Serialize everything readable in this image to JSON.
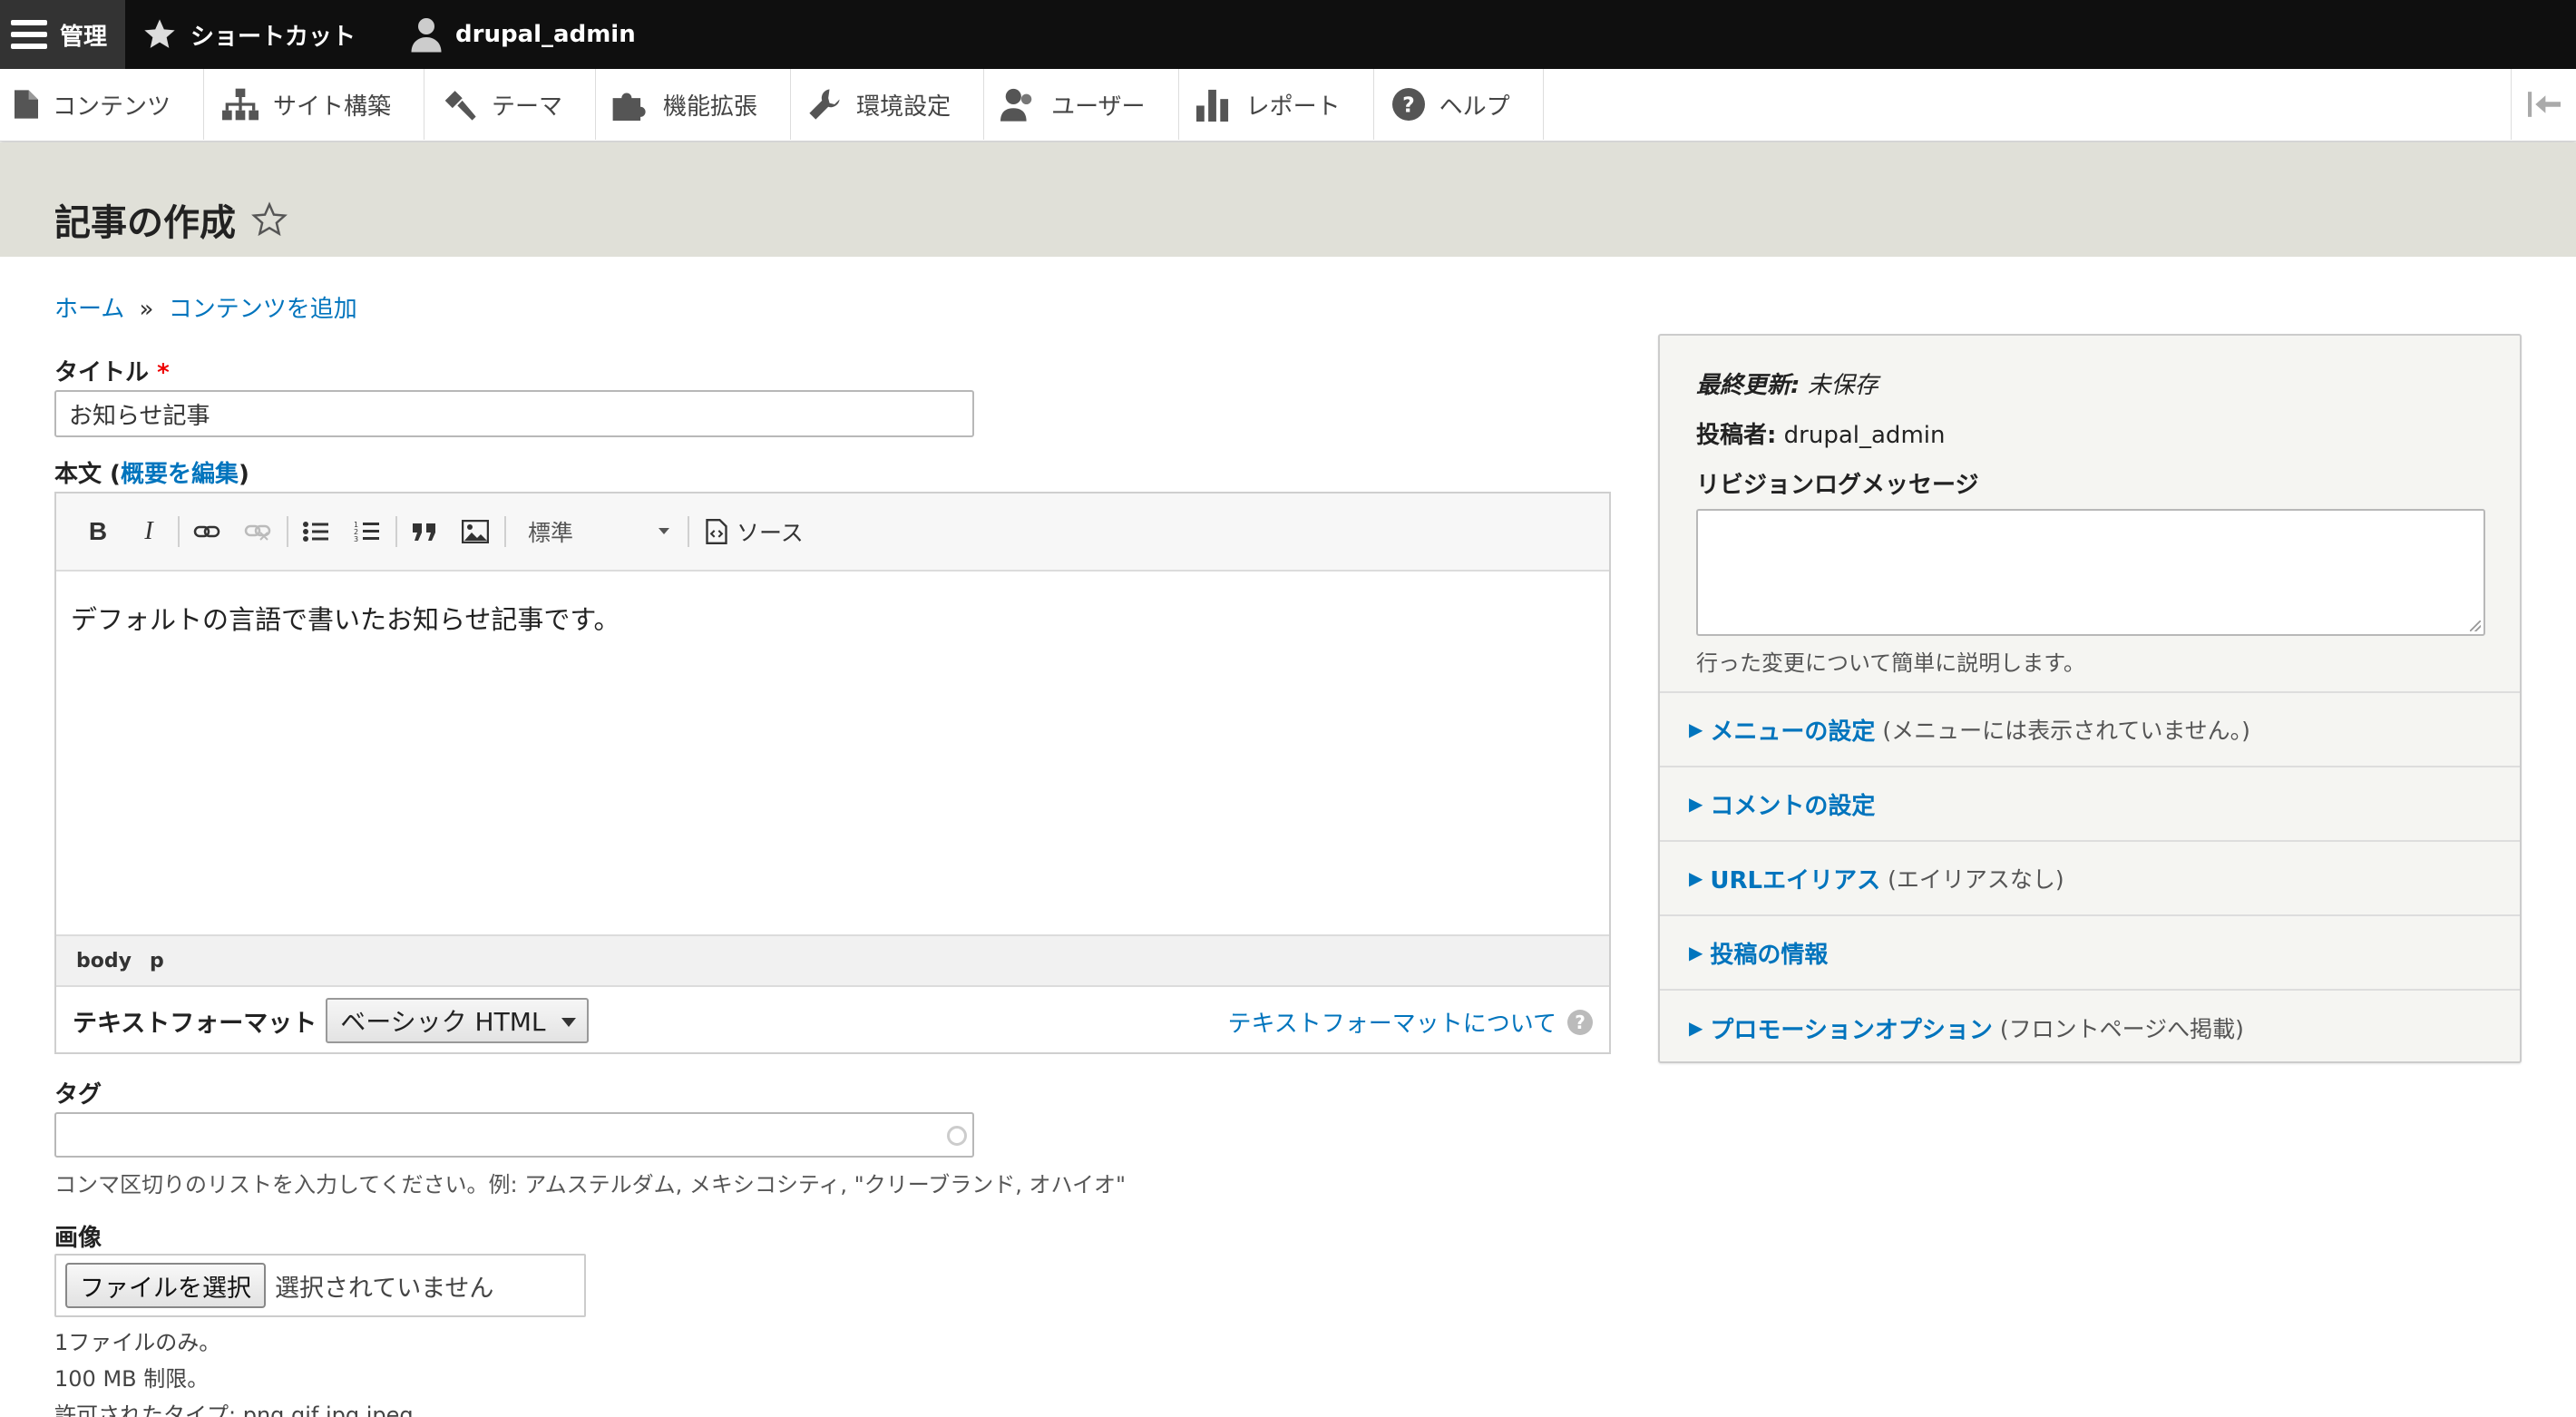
{
  "toolbar": {
    "manage_label": "管理",
    "shortcuts_label": "ショートカット",
    "user_label": "drupal_admin"
  },
  "tray": {
    "items": [
      {
        "label": "コンテンツ",
        "icon": "file-icon"
      },
      {
        "label": "サイト構築",
        "icon": "sitemap-icon"
      },
      {
        "label": "テーマ",
        "icon": "paintbrush-icon"
      },
      {
        "label": "機能拡張",
        "icon": "puzzle-icon"
      },
      {
        "label": "環境設定",
        "icon": "wrench-icon"
      },
      {
        "label": "ユーザー",
        "icon": "people-icon"
      },
      {
        "label": "レポート",
        "icon": "bar-chart-icon"
      },
      {
        "label": "ヘルプ",
        "icon": "help-icon"
      }
    ]
  },
  "page": {
    "title": "記事の作成"
  },
  "breadcrumb": {
    "home": "ホーム",
    "separator": "»",
    "add_content": "コンテンツを追加"
  },
  "form": {
    "title_label": "タイトル",
    "title_required": "*",
    "title_value": "お知らせ記事",
    "body_label_prefix": "本文 (",
    "body_edit_summary": "概要を編集",
    "body_label_suffix": ")",
    "editor": {
      "bold": "B",
      "italic": "I",
      "format_option": "標準",
      "source_label": "ソース",
      "content": "デフォルトの言語で書いたお知らせ記事です。",
      "path_body": "body",
      "path_p": "p"
    },
    "text_format_label": "テキストフォーマット",
    "text_format_value": "ベーシック HTML",
    "text_format_help": "テキストフォーマットについて",
    "tags_label": "タグ",
    "tags_description": "コンマ区切りのリストを入力してください。例: アムステルダム, メキシコシティ, \"クリーブランド, オハイオ\"",
    "image_label": "画像",
    "file_button": "ファイルを選択",
    "file_status": "選択されていません",
    "image_desc_1": "1ファイルのみ。",
    "image_desc_2": "100 MB 制限。",
    "image_desc_3": "許可されたタイプ: png gif jpg jpeg。"
  },
  "sidebar": {
    "last_updated_label": "最終更新:",
    "last_updated_value": "未保存",
    "author_label": "投稿者:",
    "author_value": "drupal_admin",
    "revision_label": "リビジョンログメッセージ",
    "revision_desc": "行った変更について簡単に説明します。",
    "details": [
      {
        "label": "メニューの設定",
        "summary": "(メニューには表示されていません。)"
      },
      {
        "label": "コメントの設定",
        "summary": ""
      },
      {
        "label": "URLエイリアス",
        "summary": "(エイリアスなし)"
      },
      {
        "label": "投稿の情報",
        "summary": ""
      },
      {
        "label": "プロモーションオプション",
        "summary": "(フロントページへ掲載)"
      }
    ]
  },
  "colors": {
    "link": "#0074bd",
    "toolbar_bg": "#0f0f0f",
    "header_bg": "#e0e0d8",
    "required": "#ee0000"
  }
}
